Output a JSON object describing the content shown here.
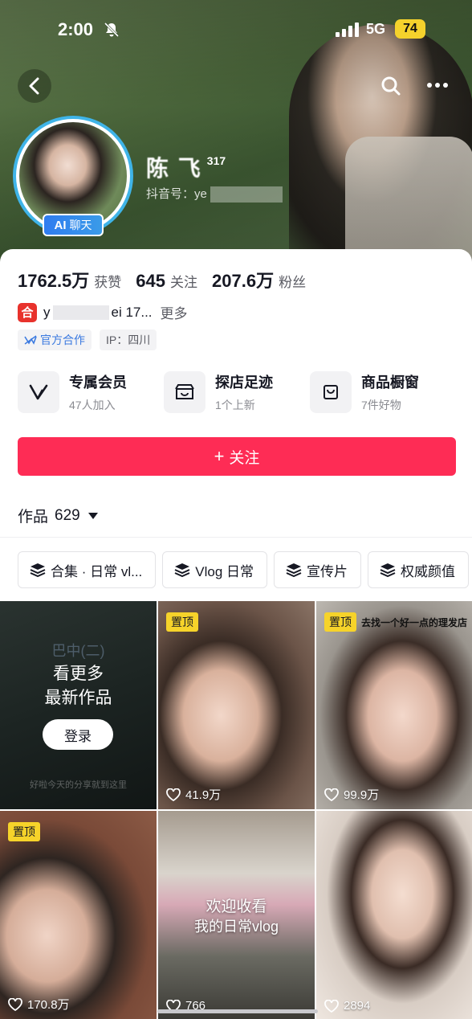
{
  "status_bar": {
    "time": "2:00",
    "network": "5G",
    "battery": "74"
  },
  "profile": {
    "name": "陈 飞",
    "name_sup": "317",
    "douyin_id_label": "抖音号：ye",
    "ai_badge_bold": "AI",
    "ai_badge_text": "聊天"
  },
  "stats": [
    {
      "value": "1762.5万",
      "label": "获赞"
    },
    {
      "value": "645",
      "label": "关注"
    },
    {
      "value": "207.6万",
      "label": "粉丝"
    }
  ],
  "bio": {
    "icon_text": "合",
    "text_start": "y",
    "text_end": "ei 17...",
    "more": "更多"
  },
  "tags": {
    "official": "官方合作",
    "ip": "IP：四川"
  },
  "features": [
    {
      "title": "专属会员",
      "sub": "47人加入",
      "icon": "v-icon"
    },
    {
      "title": "探店足迹",
      "sub": "1个上新",
      "icon": "store-icon"
    },
    {
      "title": "商品橱窗",
      "sub": "7件好物",
      "icon": "bag-icon"
    }
  ],
  "follow_button": {
    "plus": "+",
    "label": "关注"
  },
  "works": {
    "label": "作品",
    "count": "629"
  },
  "chips": [
    "合集 · 日常 vl...",
    "Vlog 日常",
    "宣传片",
    "权威颜值"
  ],
  "grid": {
    "promo": {
      "watermark": "巴中(二)",
      "line1": "看更多",
      "line2": "最新作品",
      "login": "登录",
      "caption": "好啦今天的分享就到这里"
    },
    "pin_label": "置顶",
    "cells": [
      {
        "likes": "41.9万"
      },
      {
        "likes": "99.9万",
        "corner_text": "去找一个好一点的理发店"
      },
      {
        "likes": "170.8万"
      },
      {
        "likes": "766",
        "caption1": "欢迎收看",
        "caption2": "我的日常vlog"
      },
      {
        "likes": "2894"
      }
    ]
  },
  "colors": {
    "accent": "#fe2c55",
    "pin": "#f6d32a",
    "avatar_ring": "#3fb4e8",
    "official_tag": "#3b7ae0"
  }
}
